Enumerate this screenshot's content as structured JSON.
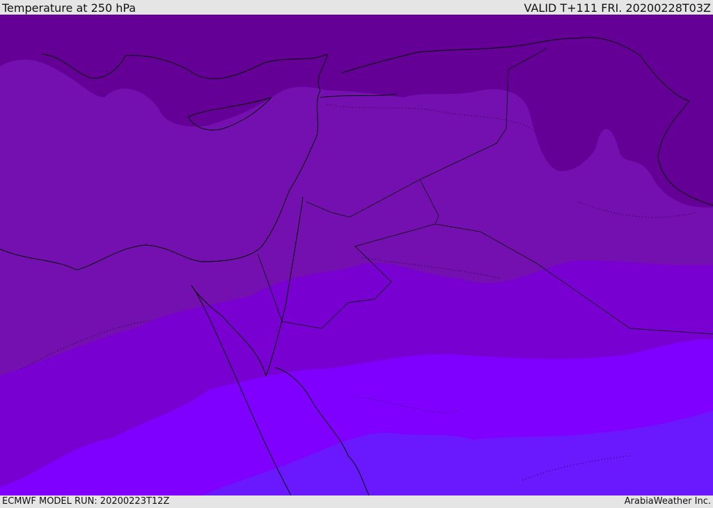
{
  "header": {
    "title": "Temperature at 250 hPa",
    "valid": "VALID T+111 FRI. 20200228T03Z"
  },
  "footer": {
    "model_run": "ECMWF MODEL RUN: 20200223T12Z",
    "credit": "ArabiaWeather Inc."
  },
  "colors": {
    "band1": "#650096",
    "band2": "#7510b0",
    "band3": "#7800d0",
    "band4": "#8000ff",
    "band5": "#6a19ff",
    "background": "#e5e5e5"
  }
}
